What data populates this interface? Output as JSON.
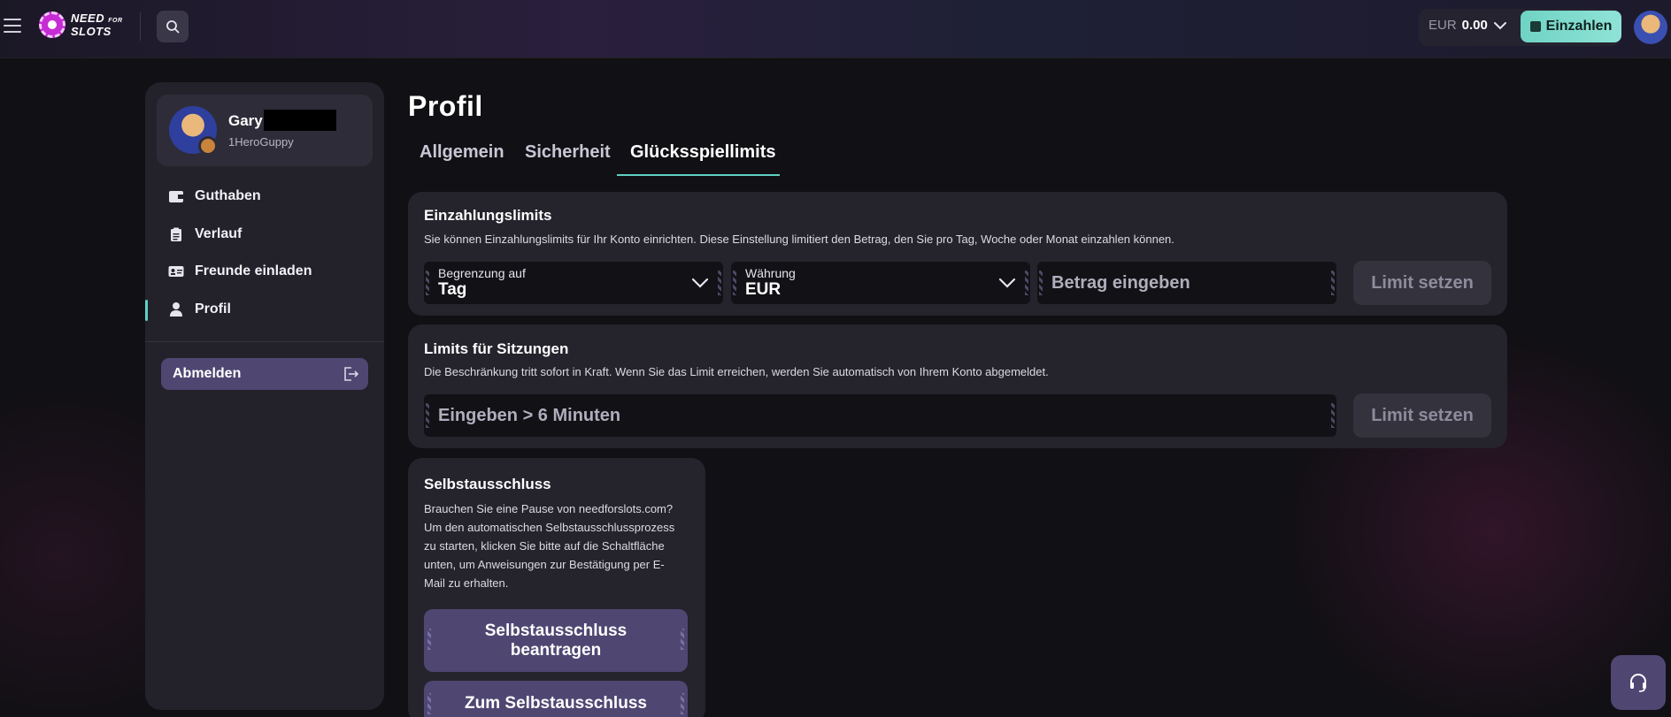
{
  "header": {
    "logo_line1": "NEED",
    "logo_for": "FOR",
    "logo_line2": "SLOTS",
    "balance_currency": "EUR",
    "balance_amount": "0.00",
    "deposit_label": "Einzahlen"
  },
  "user": {
    "name": "Gary",
    "handle": "1HeroGuppy"
  },
  "sidebar": {
    "items": [
      {
        "label": "Guthaben",
        "icon": "wallet-icon"
      },
      {
        "label": "Verlauf",
        "icon": "clipboard-icon"
      },
      {
        "label": "Freunde einladen",
        "icon": "id-card-icon"
      },
      {
        "label": "Profil",
        "icon": "user-icon"
      }
    ],
    "logout_label": "Abmelden"
  },
  "main": {
    "title": "Profil",
    "tabs": [
      {
        "label": "Allgemein"
      },
      {
        "label": "Sicherheit"
      },
      {
        "label": "Glücksspiellimits"
      }
    ],
    "active_tab": "Glücksspiellimits"
  },
  "deposit_limits": {
    "title": "Einzahlungslimits",
    "description": "Sie können Einzahlungslimits für Ihr Konto einrichten. Diese Einstellung limitiert den Betrag, den Sie pro Tag, Woche oder Monat einzahlen können.",
    "period_label": "Begrenzung auf",
    "period_value": "Tag",
    "currency_label": "Währung",
    "currency_value": "EUR",
    "amount_placeholder": "Betrag eingeben",
    "button_label": "Limit setzen"
  },
  "session_limits": {
    "title": "Limits für Sitzungen",
    "description": "Die Beschränkung tritt sofort in Kraft. Wenn Sie das Limit erreichen, werden Sie automatisch von Ihrem Konto abgemeldet.",
    "input_placeholder": "Eingeben > 6 Minuten",
    "button_label": "Limit setzen"
  },
  "self_exclusion": {
    "title": "Selbstausschluss",
    "desc_lines": [
      "Brauchen Sie eine Pause von needforslots.com?",
      "Um den automatischen Selbstausschlussprozess",
      "zu starten, klicken Sie bitte auf die Schaltfläche",
      "unten, um Anweisungen zur Bestätigung per E-",
      "Mail zu erhalten."
    ],
    "request_line1": "Selbstausschluss",
    "request_line2": "beantragen",
    "goto_label": "Zum Selbstausschluss"
  },
  "colors": {
    "accent": "#5fd1c2",
    "button_purple": "#4f4772",
    "panel": "#25232c"
  }
}
